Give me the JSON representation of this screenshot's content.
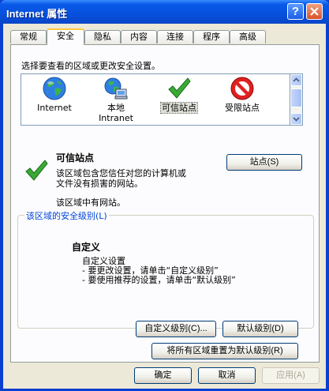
{
  "window": {
    "title": "Internet 属性"
  },
  "title_buttons": {
    "help": "?"
  },
  "tabs": [
    {
      "label": "常规"
    },
    {
      "label": "安全"
    },
    {
      "label": "隐私"
    },
    {
      "label": "内容"
    },
    {
      "label": "连接"
    },
    {
      "label": "程序"
    },
    {
      "label": "高级"
    }
  ],
  "security": {
    "instruction": "选择要查看的区域或更改安全设置。",
    "zones": [
      {
        "label": "Internet",
        "icon": "globe-icon"
      },
      {
        "label_line1": "本地",
        "label_line2": "Intranet",
        "icon": "intranet-icon"
      },
      {
        "label": "可信站点",
        "icon": "check-icon"
      },
      {
        "label": "受限站点",
        "icon": "no-entry-icon"
      }
    ],
    "selected_zone": "可信站点",
    "zone_title": "可信站点",
    "zone_desc_line1": "该区域包含您信任对您的计算机或",
    "zone_desc_line2": "文件没有损害的网站。",
    "zone_note": "该区域中有网站。",
    "sites_button": "站点(S)",
    "group_label": "该区域的安全级别(L)",
    "level_title": "自定义",
    "level_lines": [
      "自定义设置",
      "- 要更改设置，请单击“自定义级别”",
      "- 要使用推荐的设置，请单击“默认级别”"
    ],
    "custom_level_button": "自定义级别(C)...",
    "default_level_button": "默认级别(D)",
    "reset_all_button": "将所有区域重置为默认级别(R)"
  },
  "dialog": {
    "ok": "确定",
    "cancel": "取消",
    "apply": "应用(A)"
  },
  "colors": {
    "titlebar": "#0650dd",
    "face": "#ece9d8",
    "panel": "#fcfcfe",
    "accent_tab": "#ffc83c",
    "link_blue": "#0046d5"
  }
}
